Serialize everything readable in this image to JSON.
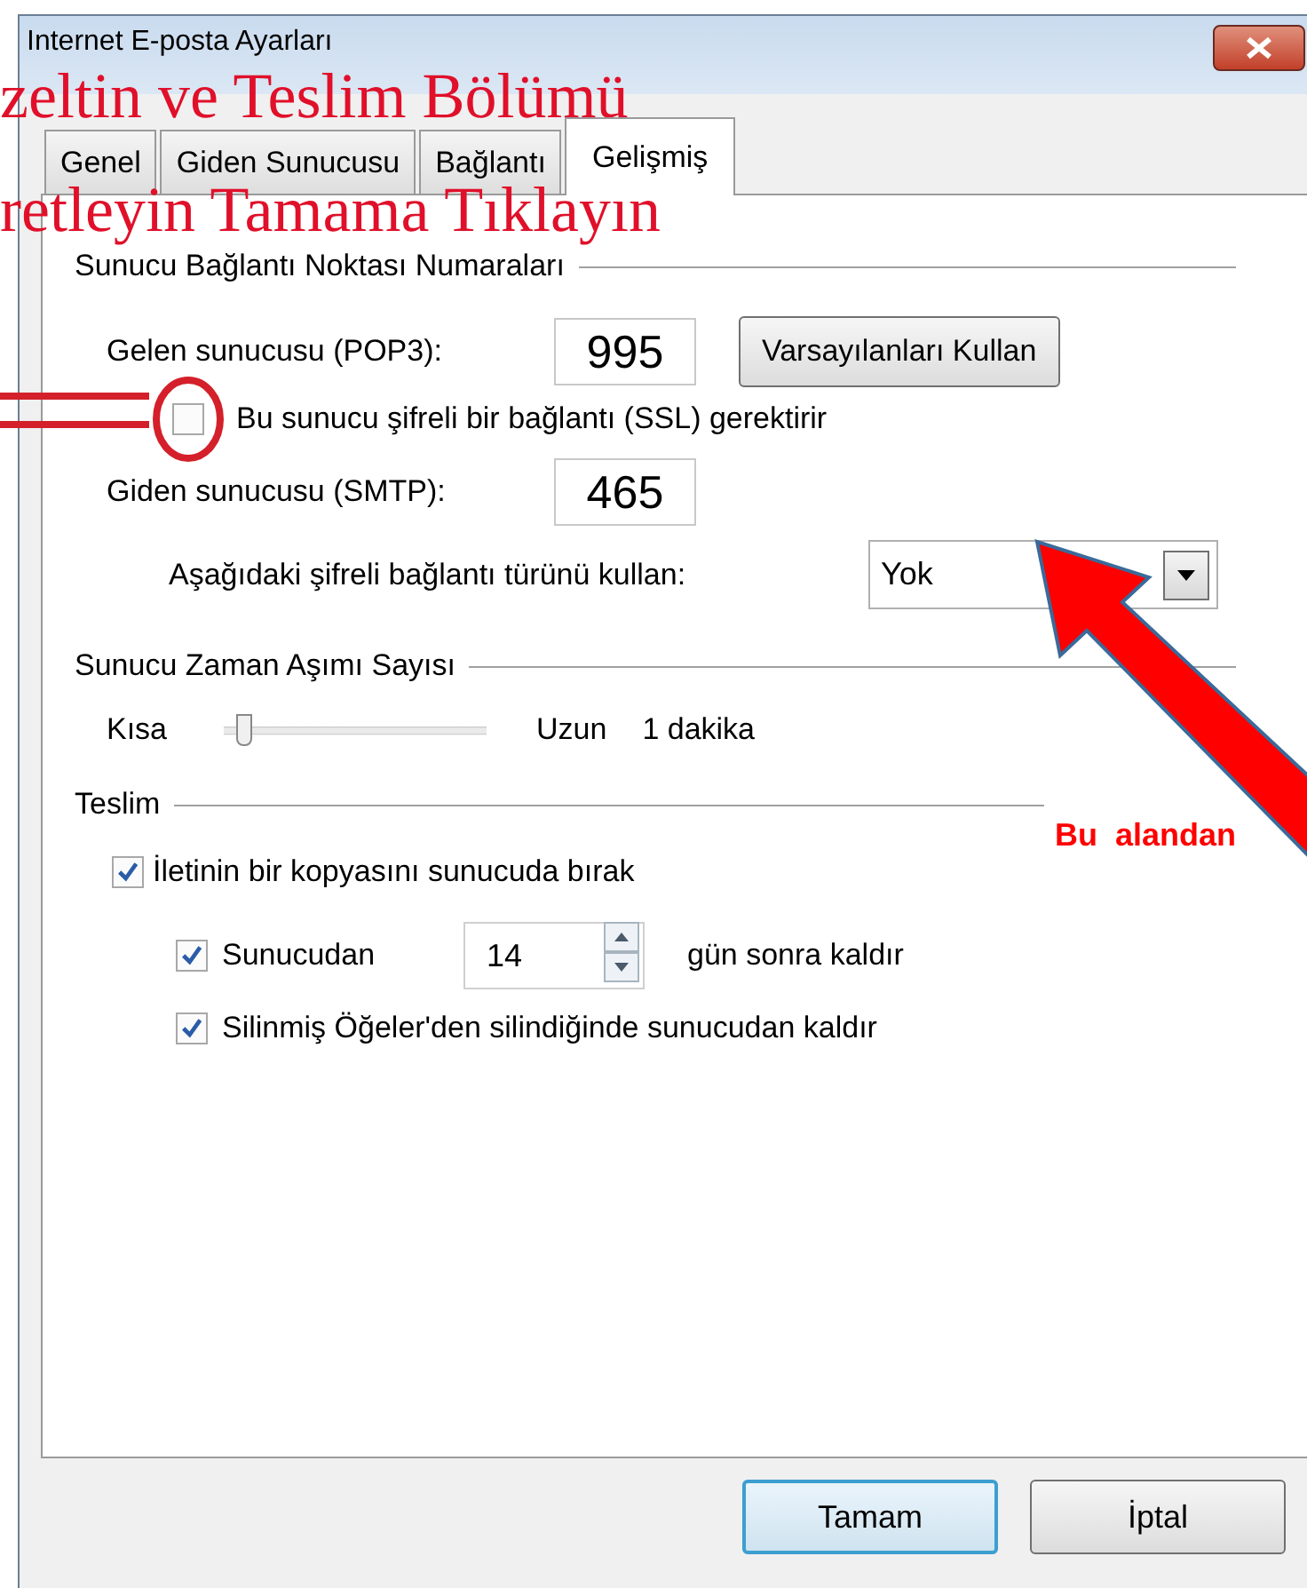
{
  "window": {
    "title": "Internet E-posta Ayarları"
  },
  "tabs": [
    {
      "label": "Genel",
      "selected": false
    },
    {
      "label": "Giden Sunucusu",
      "selected": false
    },
    {
      "label": "Bağlantı",
      "selected": false
    },
    {
      "label": "Gelişmiş",
      "selected": true
    }
  ],
  "ports": {
    "title": "Sunucu Bağlantı Noktası Numaraları",
    "incoming_label": "Gelen sunucusu (POP3):",
    "incoming_value": "995",
    "defaults_button": "Varsayılanları Kullan",
    "ssl": {
      "label": "Bu sunucu şifreli bir bağlantı (SSL) gerektirir",
      "checked": false
    },
    "outgoing_label": "Giden sunucusu (SMTP):",
    "outgoing_value": "465",
    "encryption_label": "Aşağıdaki şifreli bağlantı türünü kullan:",
    "encryption_value": "Yok"
  },
  "timeout": {
    "title": "Sunucu Zaman Aşımı Sayısı",
    "short_label": "Kısa",
    "level": 0.05,
    "long_label": "Uzun",
    "reading": "1 dakika"
  },
  "delivery": {
    "title": "Teslim",
    "leave_copy": {
      "label": "İletinin bir kopyasını sunucuda bırak",
      "checked": true
    },
    "remove_after": {
      "label": "Sunucudan",
      "checked": true,
      "value": "14",
      "suffix": "gün sonra kaldır"
    },
    "remove_deleted": {
      "label": "Silinmiş Öğeler'den silindiğinde sunucudan kaldır",
      "checked": true
    }
  },
  "buttons": [
    {
      "label": "Tamam",
      "default": true
    },
    {
      "label": "İptal",
      "default": false
    }
  ],
  "annotations": {
    "lines": [
      "zeltin ve Teslim  Bölümü",
      "retleyin Tamama Tıklayın"
    ],
    "callout": "Bu  alandan"
  }
}
